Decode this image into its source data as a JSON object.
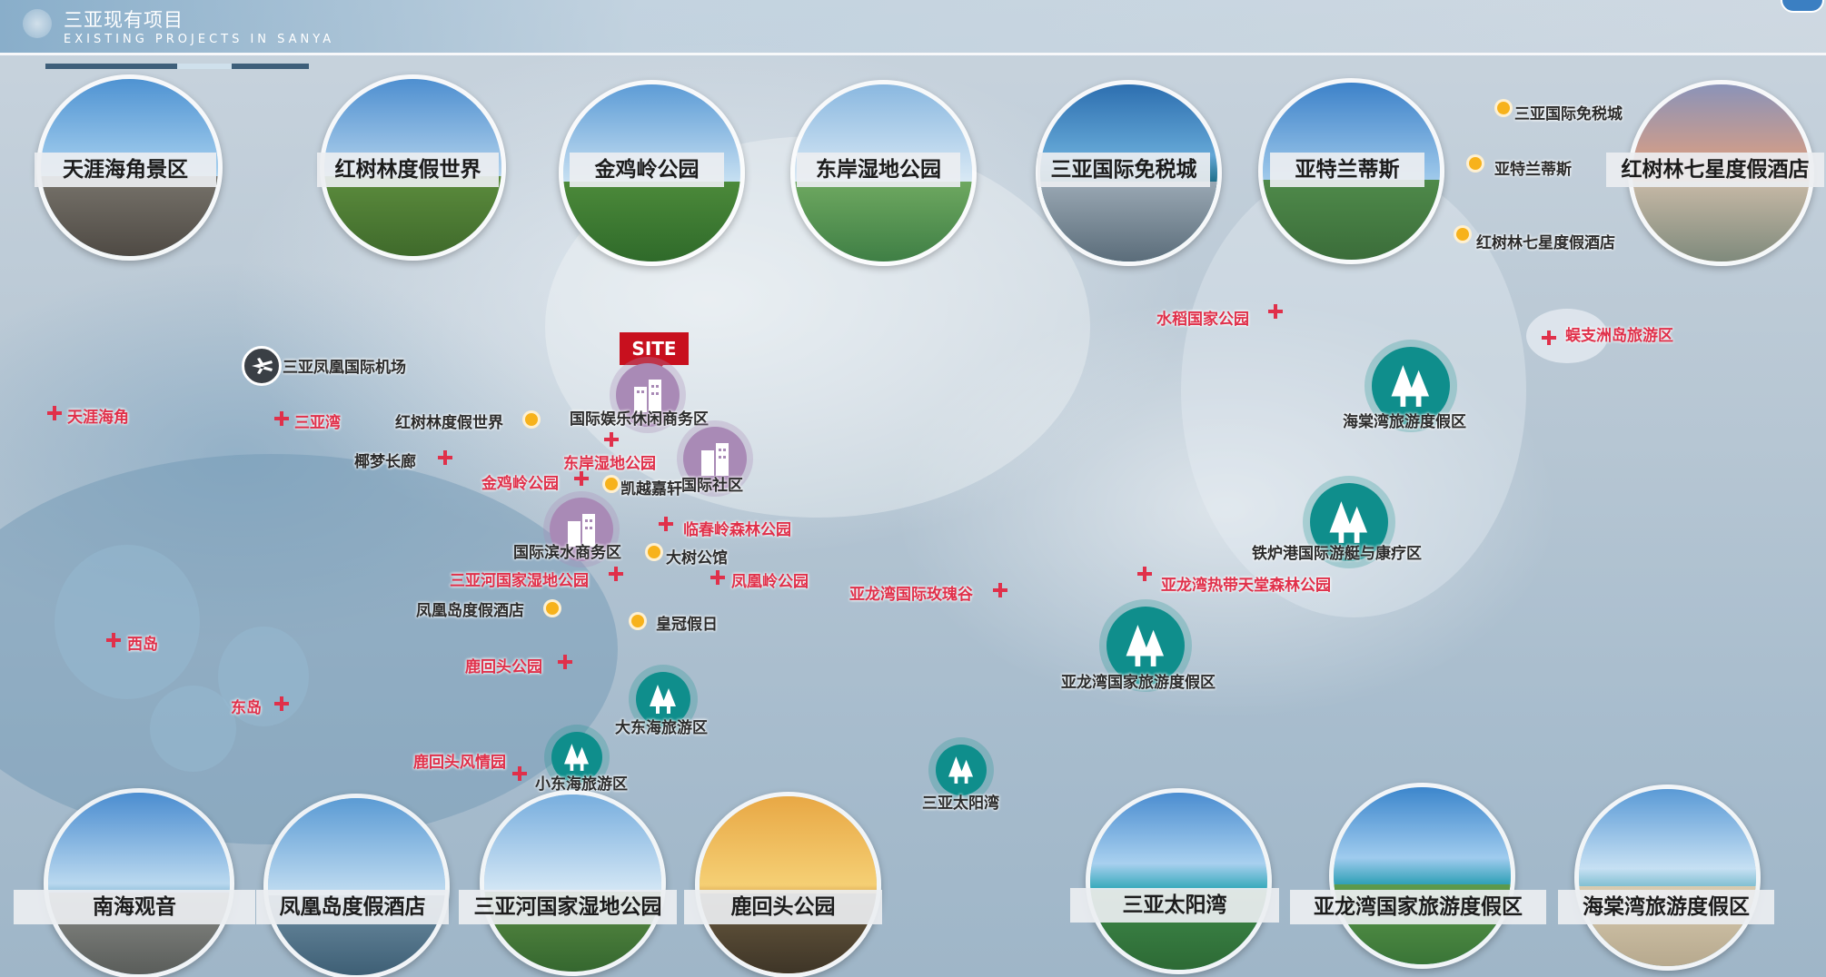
{
  "header": {
    "title_cn": "三亚现有项目",
    "title_en": "EXISTING PROJECTS IN SANYA"
  },
  "top_photos": [
    {
      "label": "天涯海角景区"
    },
    {
      "label": "红树林度假世界"
    },
    {
      "label": "金鸡岭公园"
    },
    {
      "label": "东岸湿地公园"
    },
    {
      "label": "三亚国际免税城"
    },
    {
      "label": "亚特兰蒂斯"
    },
    {
      "label": "红树林七星度假酒店"
    }
  ],
  "bottom_photos": [
    {
      "label": "南海观音"
    },
    {
      "label": "凤凰岛度假酒店"
    },
    {
      "label": "三亚河国家湿地公园"
    },
    {
      "label": "鹿回头公园"
    },
    {
      "label": "三亚太阳湾"
    },
    {
      "label": "亚龙湾国家旅游度假区"
    },
    {
      "label": "海棠湾旅游度假区"
    }
  ],
  "site_label": "SITE",
  "airport_label": "三亚凤凰国际机场",
  "red_labels": {
    "tianya": "天涯海角",
    "sanya_bay": "三亚湾",
    "dongan": "东岸湿地公园",
    "jinjiling": "金鸡岭公园",
    "linchunling": "临春岭森林公园",
    "sanyahe": "三亚河国家湿地公园",
    "fenghuangling": "凤凰岭公园",
    "luhuitou": "鹿回头公园",
    "luhuitou_scenic": "鹿回头风情园",
    "xidao": "西岛",
    "dongdao": "东岛",
    "yalong_rose": "亚龙湾国际玫瑰谷",
    "yalong_forest": "亚龙湾热带天堂森林公园",
    "shuidao": "水稻国家公园",
    "wuzhizhou": "蜈支洲岛旅游区"
  },
  "dark_labels": {
    "hongshulin": "红树林度假世界",
    "yemeng": "椰梦长廊",
    "kaiyue": "凯越嘉轩",
    "dashu": "大树公馆",
    "fenghuangdao": "凤凰岛度假酒店",
    "huangguan": "皇冠假日",
    "dfs": "三亚国际免税城",
    "atlantis": "亚特兰蒂斯",
    "hongshulin7": "红树林七星度假酒店"
  },
  "buildings": {
    "yule": "国际娱乐休闲商务区",
    "shequ": "国际社区",
    "binshui": "国际滨水商务区"
  },
  "trees": {
    "dadonghai": "大东海旅游区",
    "xiaodonghai": "小东海旅游区",
    "taiyangwan": "三亚太阳湾",
    "yalongwan": "亚龙湾国家旅游度假区",
    "tieluport": "铁炉港国际游艇与康疗区",
    "haitangwan": "海棠湾旅游度假区"
  },
  "colors": {
    "red": "#e0304a",
    "teal": "#0f8e8c",
    "purple": "#a98ab6",
    "yellow": "#f7b21b"
  }
}
